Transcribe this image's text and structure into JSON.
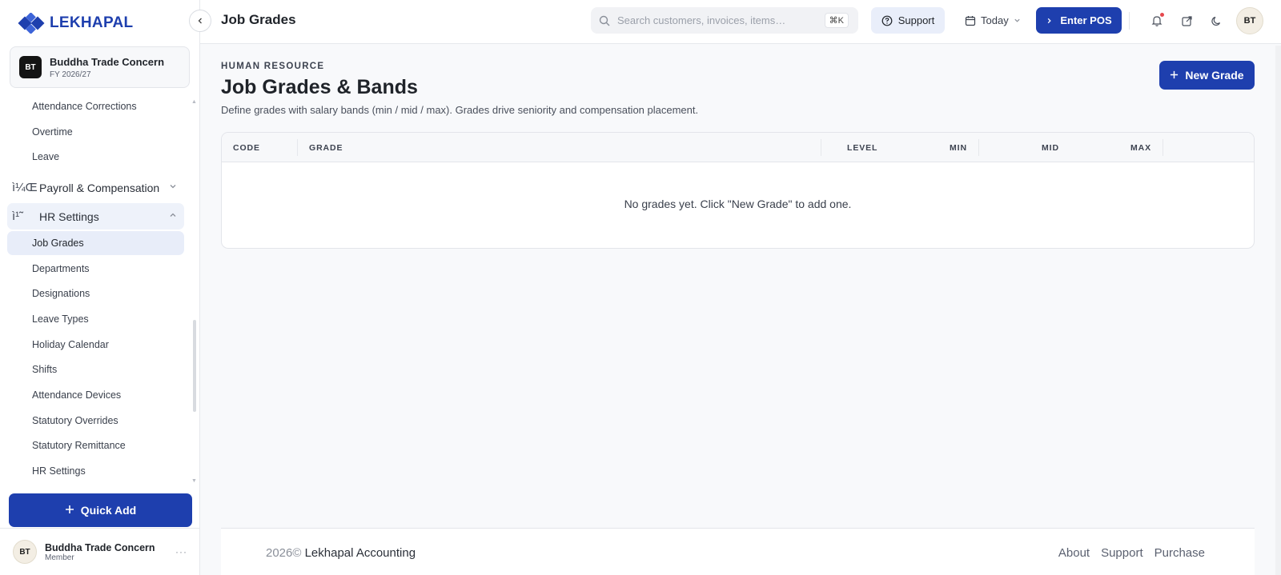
{
  "brand": {
    "name": "LEKHAPAL"
  },
  "org": {
    "initials": "BT",
    "name": "Buddha Trade Concern",
    "fy": "FY 2026/27"
  },
  "sidebar": {
    "items_top": [
      "Attendance Corrections",
      "Overtime",
      "Leave"
    ],
    "group_payroll": {
      "icon": "ì¼Œ",
      "label": "Payroll & Compensation"
    },
    "group_hr": {
      "icon": "ì¹˜",
      "label": "HR Settings"
    },
    "hr_items": [
      "Job Grades",
      "Departments",
      "Designations",
      "Leave Types",
      "Holiday Calendar",
      "Shifts",
      "Attendance Devices",
      "Statutory Overrides",
      "Statutory Remittance",
      "HR Settings"
    ],
    "active_item": "Job Grades",
    "quick_add": "Quick Add"
  },
  "user": {
    "initials": "BT",
    "name": "Buddha Trade Concern",
    "role": "Member"
  },
  "header": {
    "title": "Job Grades",
    "search_placeholder": "Search customers, invoices, items…",
    "search_shortcut": "⌘K",
    "support": "Support",
    "date_filter": "Today",
    "pos": "Enter POS",
    "avatar": "BT"
  },
  "page": {
    "eyebrow": "HUMAN RESOURCE",
    "title": "Job Grades & Bands",
    "subtitle": "Define grades with salary bands (min / mid / max). Grades drive seniority and compensation placement.",
    "new_button": "New Grade"
  },
  "table": {
    "columns": [
      "CODE",
      "GRADE",
      "LEVEL",
      "MIN",
      "MID",
      "MAX"
    ],
    "rows": [],
    "empty_message": "No grades yet. Click \"New Grade\" to add one."
  },
  "footer": {
    "year": "2026©",
    "brand": "Lekhapal Accounting",
    "links": [
      "About",
      "Support",
      "Purchase"
    ]
  },
  "colors": {
    "primary": "#1e3fae",
    "active_bg": "#e8edf9",
    "notification": "#e5484d"
  }
}
